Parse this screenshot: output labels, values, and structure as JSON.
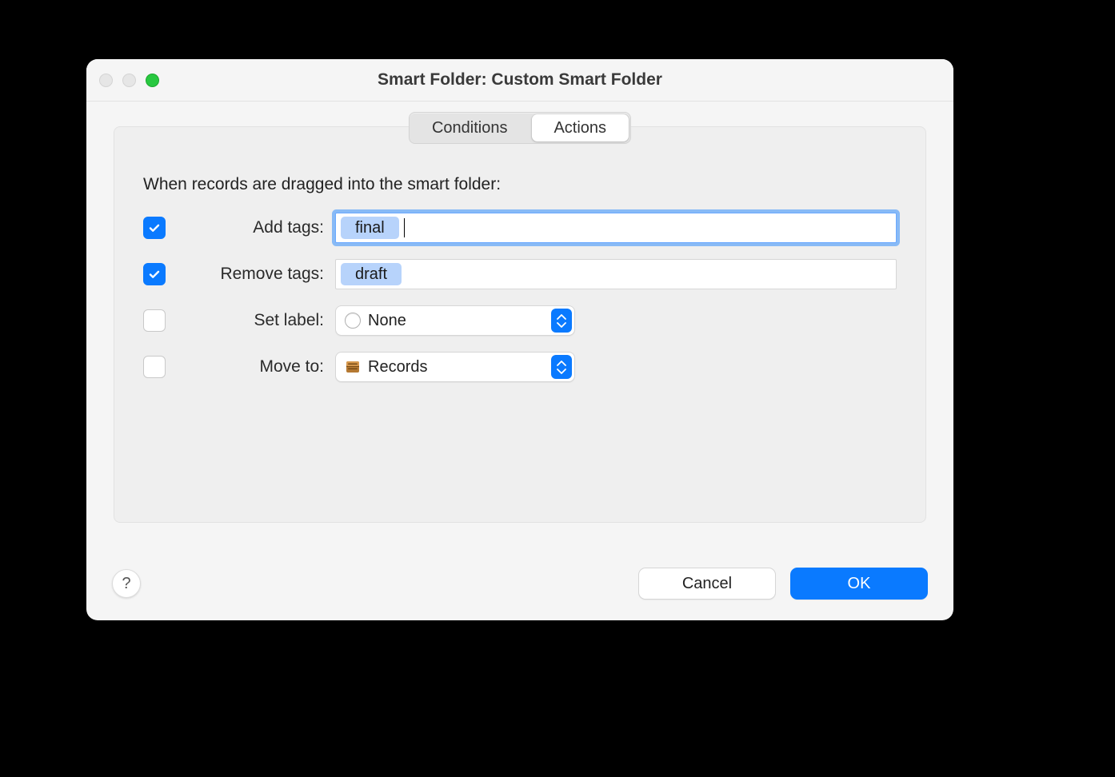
{
  "window": {
    "title": "Smart Folder: Custom Smart Folder"
  },
  "tabs": {
    "conditions": "Conditions",
    "actions": "Actions"
  },
  "intro": "When records are dragged into the smart folder:",
  "rows": {
    "add_tags": {
      "label": "Add tags:",
      "token": "final"
    },
    "remove_tags": {
      "label": "Remove tags:",
      "token": "draft"
    },
    "set_label": {
      "label": "Set label:",
      "value": "None"
    },
    "move_to": {
      "label": "Move to:",
      "value": "Records"
    }
  },
  "buttons": {
    "help": "?",
    "cancel": "Cancel",
    "ok": "OK"
  }
}
